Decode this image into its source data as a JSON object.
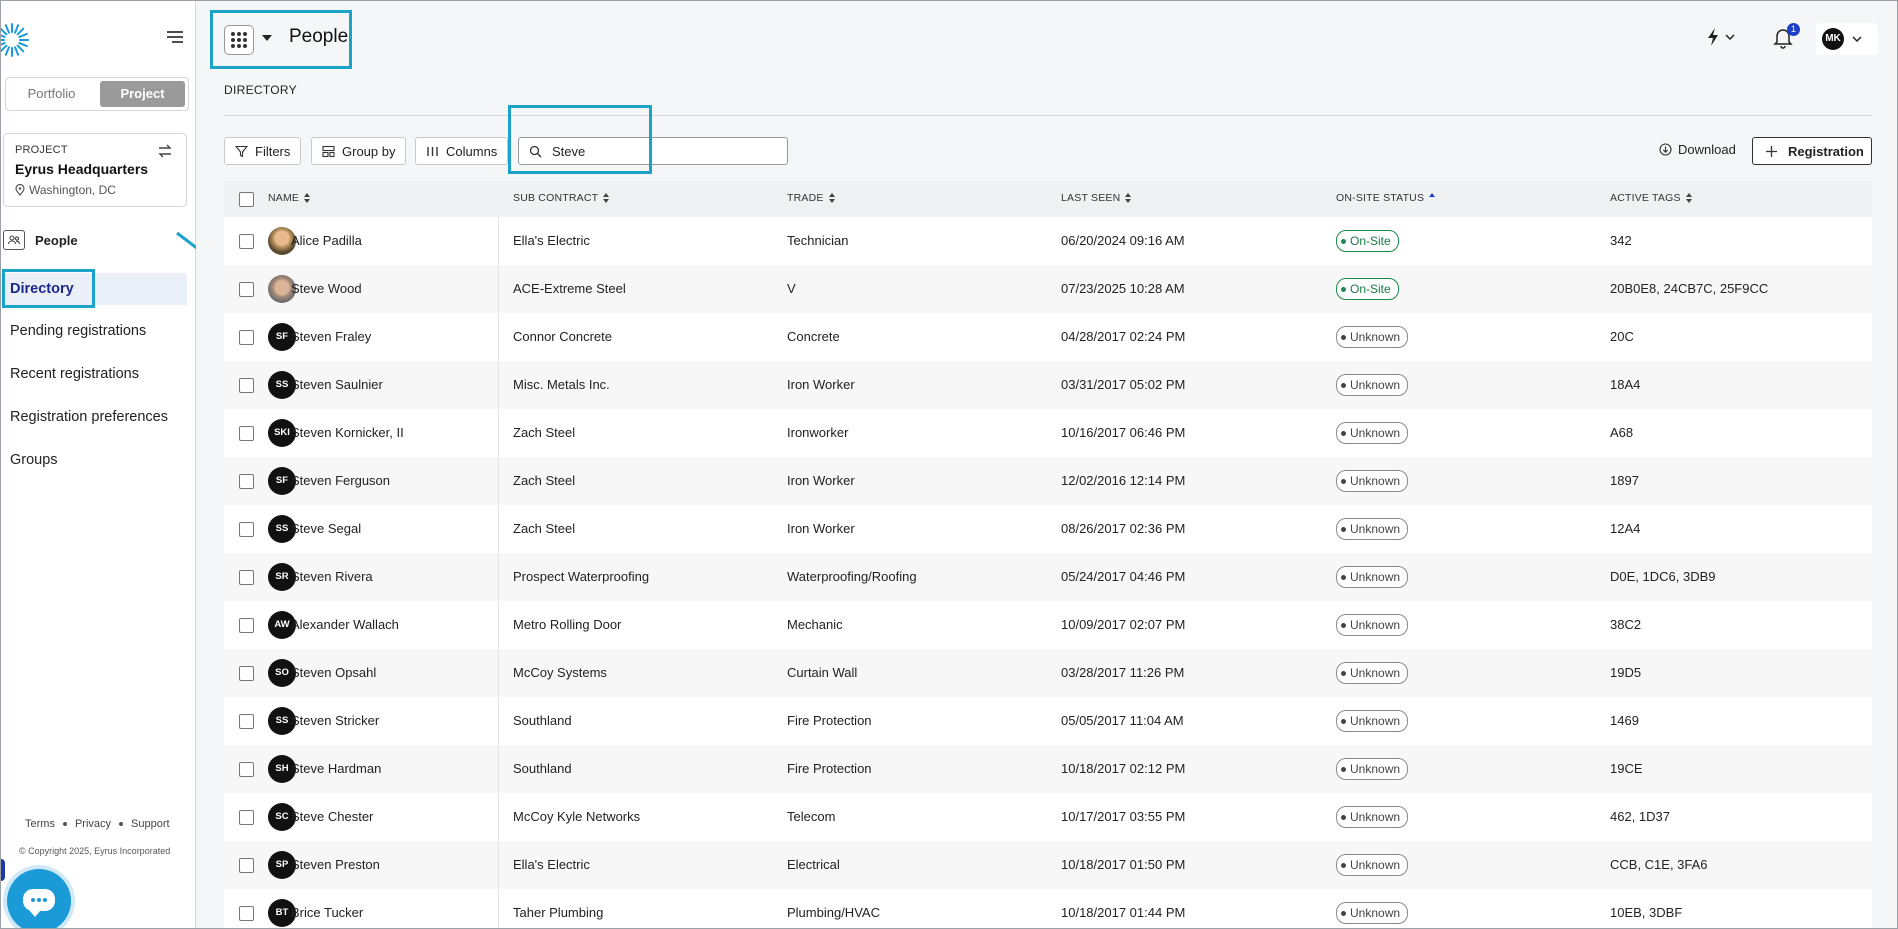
{
  "sidebar": {
    "portfolio_label": "Portfolio",
    "project_toggle_label": "Project",
    "project": {
      "label": "PROJECT",
      "name": "Eyrus Headquarters",
      "location": "Washington, DC"
    },
    "section": "People",
    "nav": [
      {
        "label": "Directory",
        "active": true
      },
      {
        "label": "Pending registrations"
      },
      {
        "label": "Recent registrations"
      },
      {
        "label": "Registration preferences"
      },
      {
        "label": "Groups"
      }
    ],
    "footer": {
      "terms": "Terms",
      "privacy": "Privacy",
      "support": "Support",
      "copyright": "© Copyright 2025, Eyrus Incorporated"
    }
  },
  "header": {
    "title": "People",
    "notifications": "1",
    "user_initials": "MK"
  },
  "directory": {
    "title": "DIRECTORY",
    "toolbar": {
      "filters": "Filters",
      "group_by": "Group by",
      "columns": "Columns",
      "search_value": "Steve",
      "download": "Download",
      "registration": "Registration"
    },
    "columns": [
      "NAME",
      "SUB CONTRACT",
      "TRADE",
      "LAST SEEN",
      "ON-SITE STATUS",
      "ACTIVE TAGS"
    ],
    "rows": [
      {
        "initials": "",
        "name": "Alice Padilla",
        "sub": "Ella's Electric",
        "trade": "Technician",
        "seen": "06/20/2024 09:16 AM",
        "status": "On-Site",
        "tags": "342"
      },
      {
        "initials": "",
        "name": "Steve Wood",
        "sub": "ACE-Extreme Steel",
        "trade": "V",
        "seen": "07/23/2025 10:28 AM",
        "status": "On-Site",
        "tags": "20B0E8, 24CB7C, 25F9CC"
      },
      {
        "initials": "SF",
        "name": "Steven Fraley",
        "sub": "Connor Concrete",
        "trade": "Concrete",
        "seen": "04/28/2017 02:24 PM",
        "status": "Unknown",
        "tags": "20C"
      },
      {
        "initials": "SS",
        "name": "Steven Saulnier",
        "sub": "Misc. Metals Inc.",
        "trade": "Iron Worker",
        "seen": "03/31/2017 05:02 PM",
        "status": "Unknown",
        "tags": "18A4"
      },
      {
        "initials": "SKI",
        "name": "Steven Kornicker, II",
        "sub": "Zach Steel",
        "trade": "Ironworker",
        "seen": "10/16/2017 06:46 PM",
        "status": "Unknown",
        "tags": "A68"
      },
      {
        "initials": "SF",
        "name": "Steven Ferguson",
        "sub": "Zach Steel",
        "trade": "Iron Worker",
        "seen": "12/02/2016 12:14 PM",
        "status": "Unknown",
        "tags": "1897"
      },
      {
        "initials": "SS",
        "name": "Steve Segal",
        "sub": "Zach Steel",
        "trade": "Iron Worker",
        "seen": "08/26/2017 02:36 PM",
        "status": "Unknown",
        "tags": "12A4"
      },
      {
        "initials": "SR",
        "name": "Steven Rivera",
        "sub": "Prospect Waterproofing",
        "trade": "Waterproofing/Roofing",
        "seen": "05/24/2017 04:46 PM",
        "status": "Unknown",
        "tags": "D0E, 1DC6, 3DB9"
      },
      {
        "initials": "AW",
        "name": "Alexander Wallach",
        "sub": "Metro Rolling Door",
        "trade": "Mechanic",
        "seen": "10/09/2017 02:07 PM",
        "status": "Unknown",
        "tags": "38C2"
      },
      {
        "initials": "SO",
        "name": "Steven Opsahl",
        "sub": "McCoy Systems",
        "trade": "Curtain Wall",
        "seen": "03/28/2017 11:26 PM",
        "status": "Unknown",
        "tags": "19D5"
      },
      {
        "initials": "SS",
        "name": "Steven Stricker",
        "sub": "Southland",
        "trade": "Fire Protection",
        "seen": "05/05/2017 11:04 AM",
        "status": "Unknown",
        "tags": "1469"
      },
      {
        "initials": "SH",
        "name": "Steve Hardman",
        "sub": "Southland",
        "trade": "Fire Protection",
        "seen": "10/18/2017 02:12 PM",
        "status": "Unknown",
        "tags": "19CE"
      },
      {
        "initials": "SC",
        "name": "Steve Chester",
        "sub": "McCoy Kyle Networks",
        "trade": "Telecom",
        "seen": "10/17/2017 03:55 PM",
        "status": "Unknown",
        "tags": "462, 1D37"
      },
      {
        "initials": "SP",
        "name": "Steven Preston",
        "sub": "Ella's Electric",
        "trade": "Electrical",
        "seen": "10/18/2017 01:50 PM",
        "status": "Unknown",
        "tags": "CCB, C1E, 3FA6"
      },
      {
        "initials": "BT",
        "name": "Brice Tucker",
        "sub": "Taher Plumbing",
        "trade": "Plumbing/HVAC",
        "seen": "10/18/2017 01:44 PM",
        "status": "Unknown",
        "tags": "10EB, 3DBF"
      }
    ]
  },
  "colors": {
    "accent": "#1d3fc7",
    "highlight": "#1ba3c9",
    "onsite": "#1a8a4a"
  }
}
